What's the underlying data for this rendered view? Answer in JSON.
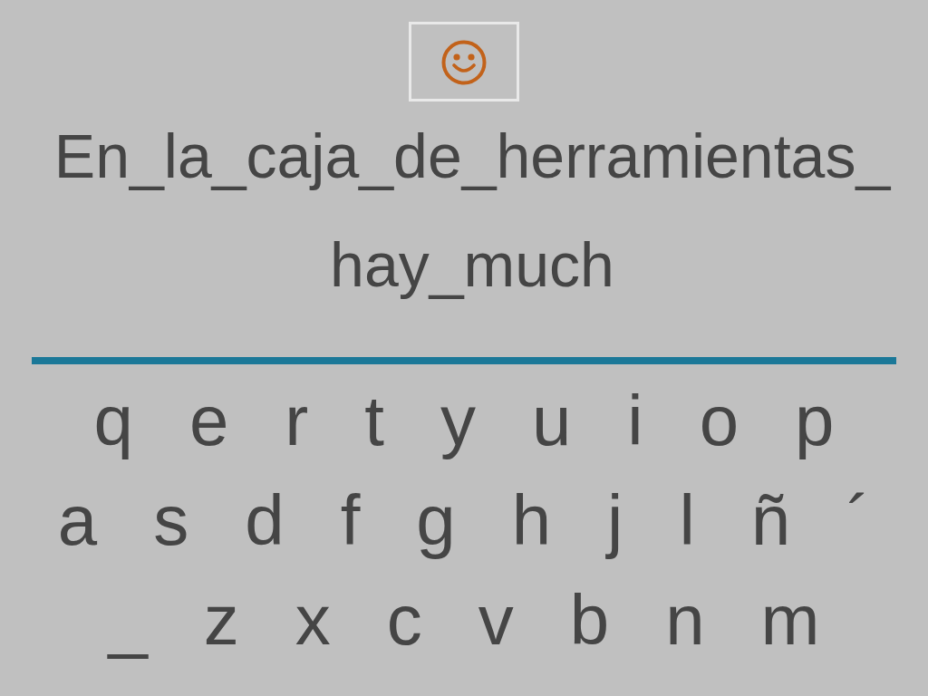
{
  "prompt": {
    "lines": [
      "En_la_caja_de_herramientas_",
      "hay_much"
    ]
  },
  "keyboard": {
    "rows": [
      [
        "q",
        "e",
        "r",
        "t",
        "y",
        "u",
        "i",
        "o",
        "p"
      ],
      [
        "a",
        "s",
        "d",
        "f",
        "g",
        "h",
        "j",
        "l",
        "ñ",
        "´"
      ],
      [
        "_",
        "z",
        "x",
        "c",
        "v",
        "b",
        "n",
        "m"
      ]
    ]
  }
}
